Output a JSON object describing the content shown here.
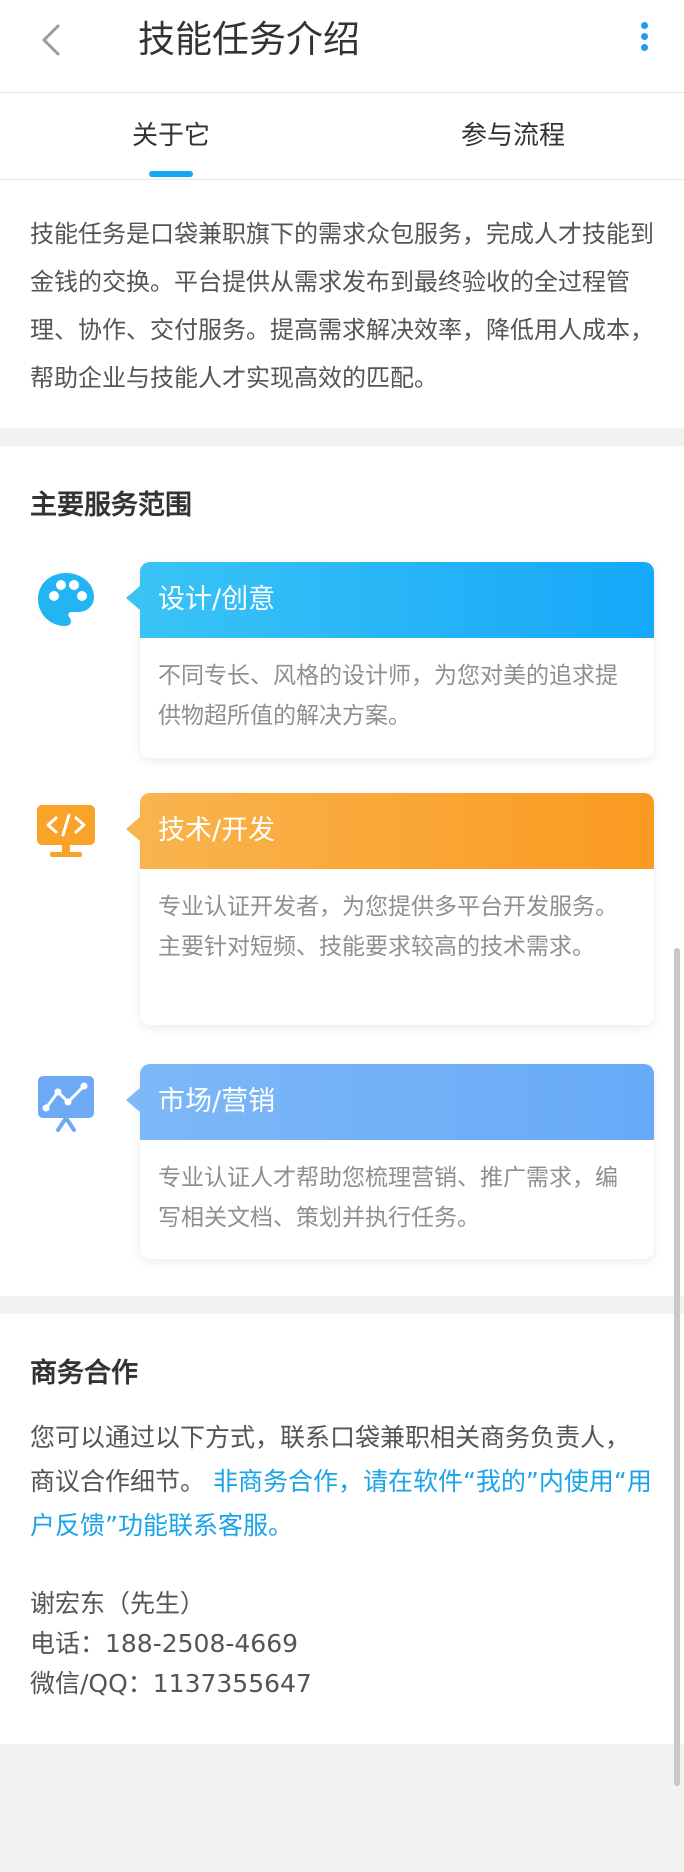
{
  "header": {
    "title": "技能任务介绍"
  },
  "tabs": [
    {
      "label": "关于它"
    },
    {
      "label": "参与流程"
    }
  ],
  "intro": "技能任务是口袋兼职旗下的需求众包服务，完成人才技能到金钱的交换。平台提供从需求发布到最终验收的全过程管理、协作、交付服务。提高需求解决效率，降低用人成本，帮助企业与技能人才实现高效的匹配。",
  "services": {
    "title": "主要服务范围",
    "items": [
      {
        "icon": "palette-icon",
        "title": "设计/创意",
        "desc": "不同专长、风格的设计师，为您对美的追求提供物超所值的解决方案。",
        "color": "#3ac3f5"
      },
      {
        "icon": "code-monitor-icon",
        "title": "技术/开发",
        "desc": "专业认证开发者，为您提供多平台开发服务。主要针对短频、技能要求较高的技术需求。",
        "color": "#f9b44e"
      },
      {
        "icon": "chart-board-icon",
        "title": "市场/营销",
        "desc": "专业认证人才帮助您梳理营销、推广需求，编写相关文档、策划并执行任务。",
        "color": "#7db8f7"
      }
    ]
  },
  "business": {
    "title": "商务合作",
    "text_main": "您可以通过以下方式，联系口袋兼职相关商务负责人，商议合作细节。",
    "text_highlight": "非商务合作，请在软件“我的”内使用“用户反馈”功能联系客服。",
    "contact_name": "谢宏东（先生）",
    "contact_phone": "电话：188-2508-4669",
    "contact_wechat": "微信/QQ：1137355647"
  }
}
